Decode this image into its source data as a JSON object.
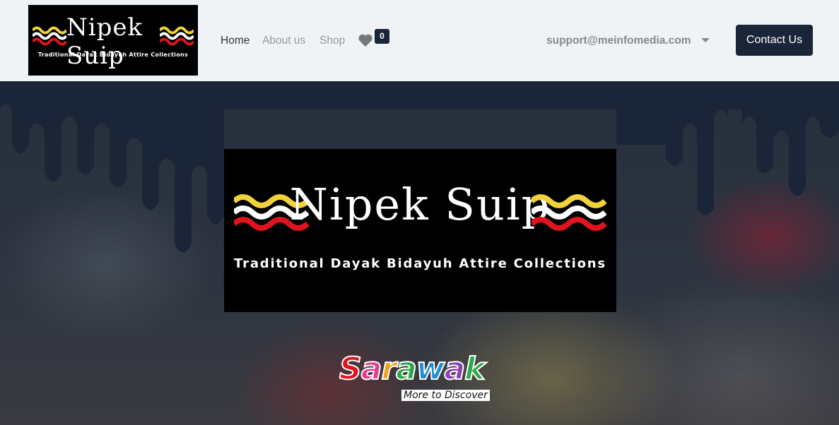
{
  "brand": {
    "name": "Nipek Suip",
    "tagline": "Traditional Dayak Bidayuh Attire Collections"
  },
  "nav": {
    "links": [
      {
        "label": "Home",
        "active": true
      },
      {
        "label": "About us",
        "active": false
      },
      {
        "label": "Shop",
        "active": false
      }
    ],
    "wishlist_icon": "heart-icon",
    "wishlist_count": "0",
    "email": "support@meinfomedia.com",
    "contact_label": "Contact Us"
  },
  "hero": {
    "logo_name": "Nipek Suip",
    "logo_tagline": "Traditional Dayak Bidayuh Attire Collections",
    "sarawak_word": "Sarawak",
    "sarawak_slogan": "More to Discover"
  },
  "colors": {
    "primary_dark": "#1b2538",
    "navbar_bg": "#f0f3f5",
    "wave_yellow": "#f2d23a",
    "wave_white": "#ffffff",
    "wave_red": "#e0141e"
  }
}
